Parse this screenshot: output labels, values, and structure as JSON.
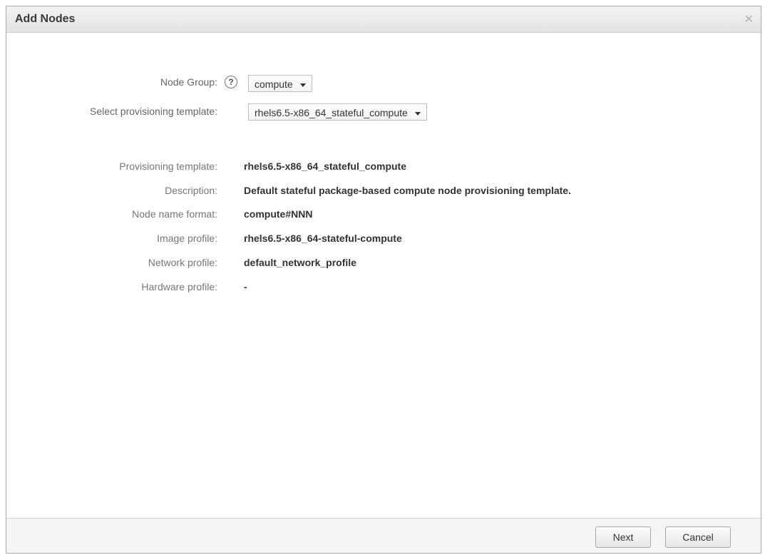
{
  "dialog": {
    "title": "Add Nodes",
    "close_symbol": "✕"
  },
  "form": {
    "node_group_label": "Node Group:",
    "node_group_value": "compute",
    "help_symbol": "?",
    "template_label": "Select provisioning template:",
    "template_value": "rhels6.5-x86_64_stateful_compute"
  },
  "details": [
    {
      "label": "Provisioning template:",
      "value": "rhels6.5-x86_64_stateful_compute"
    },
    {
      "label": "Description:",
      "value": "Default stateful package-based compute node provisioning template."
    },
    {
      "label": "Node name format:",
      "value": "compute#NNN"
    },
    {
      "label": "Image profile:",
      "value": "rhels6.5-x86_64-stateful-compute"
    },
    {
      "label": "Network profile:",
      "value": "default_network_profile"
    },
    {
      "label": "Hardware profile:",
      "value": "-"
    }
  ],
  "footer": {
    "next_label": "Next",
    "cancel_label": "Cancel"
  }
}
